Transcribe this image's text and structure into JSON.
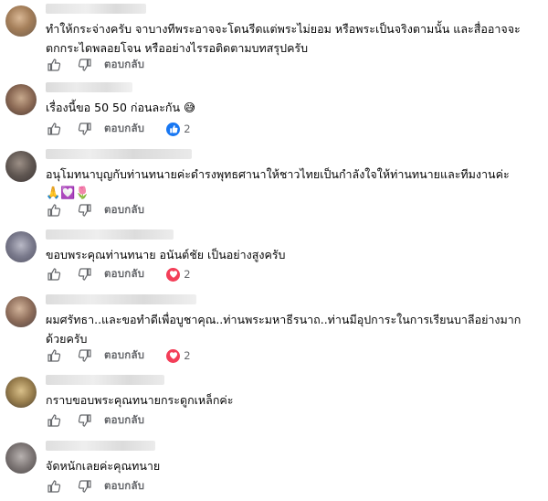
{
  "colors": {
    "text": "#050505",
    "secondary": "#65676b",
    "like_blue": "#1877f2",
    "love_red": "#f33e58"
  },
  "reply_label": "ตอบกลับ",
  "comments": [
    {
      "text_lines": [
        "ทำให้กระจ่างครับ จาบางทีพระอาจจะโดนรีดแต่พระไม่ยอม หรือพระเป็นจริงตามนั้น และสื่ออาจจะ",
        "ตกกระไดพลอยโจน หรืออย่างไรรอติดตามบทสรุปครับ"
      ],
      "reaction": null
    },
    {
      "text_lines": [
        "เรื่องนี้ขอ 50 50 ก่อนละกัน 😅"
      ],
      "reaction": {
        "type": "like-icon",
        "count": "2"
      }
    },
    {
      "text_lines": [
        "อนุโมทนาบุญกับท่านทนายค่ะดำรงพุทธศานาให้ชาวไทยเป็นกำลังใจให้ท่านทนายและทีมงานค่ะ",
        "🙏💟🌷"
      ],
      "reaction": null
    },
    {
      "text_lines": [
        "ขอบพระคุณท่านทนาย อนันต์ชัย เป็นอย่างสูงครับ"
      ],
      "reaction": {
        "type": "heart-icon",
        "count": "2"
      }
    },
    {
      "text_lines": [
        "ผมศรัทธา..และขอทำดีเพื่อบูชาคุณ..ท่านพระมหาธีรนาถ..ท่านมีอุปการะในการเรียนบาลีอย่างมาก",
        "ด้วยครับ"
      ],
      "reaction": {
        "type": "heart-icon",
        "count": "2"
      }
    },
    {
      "text_lines": [
        "กราบขอบพระคุณทนายกระดูกเหล็กค่ะ"
      ],
      "reaction": null
    },
    {
      "text_lines": [
        "จัดหนักเลยค่ะคุณทนาย"
      ],
      "reaction": null
    }
  ]
}
